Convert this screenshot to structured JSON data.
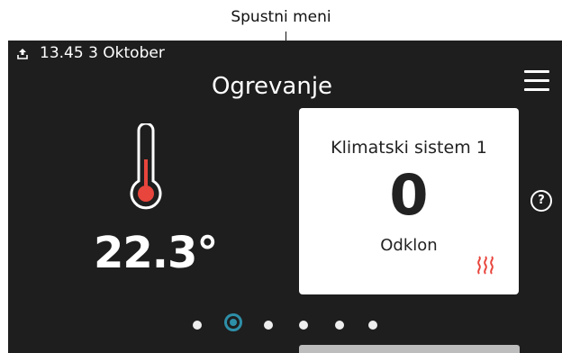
{
  "callout": {
    "label": "Spustni meni"
  },
  "status_bar": {
    "time_date": "13.45 3 Oktober",
    "upload_icon": "upload-icon"
  },
  "header": {
    "title": "Ogrevanje",
    "menu_icon": "hamburger-menu-icon"
  },
  "temperature": {
    "value": "22.3°",
    "icon": "thermometer-icon"
  },
  "climate_card": {
    "title": "Klimatski sistem 1",
    "value": "0",
    "label": "Odklon",
    "icon": "heating-icon",
    "icon_color": "#e8453c"
  },
  "help": {
    "label": "?"
  },
  "pagination": {
    "count": 6,
    "active_index": 1,
    "accent": "#2e8fa8"
  }
}
